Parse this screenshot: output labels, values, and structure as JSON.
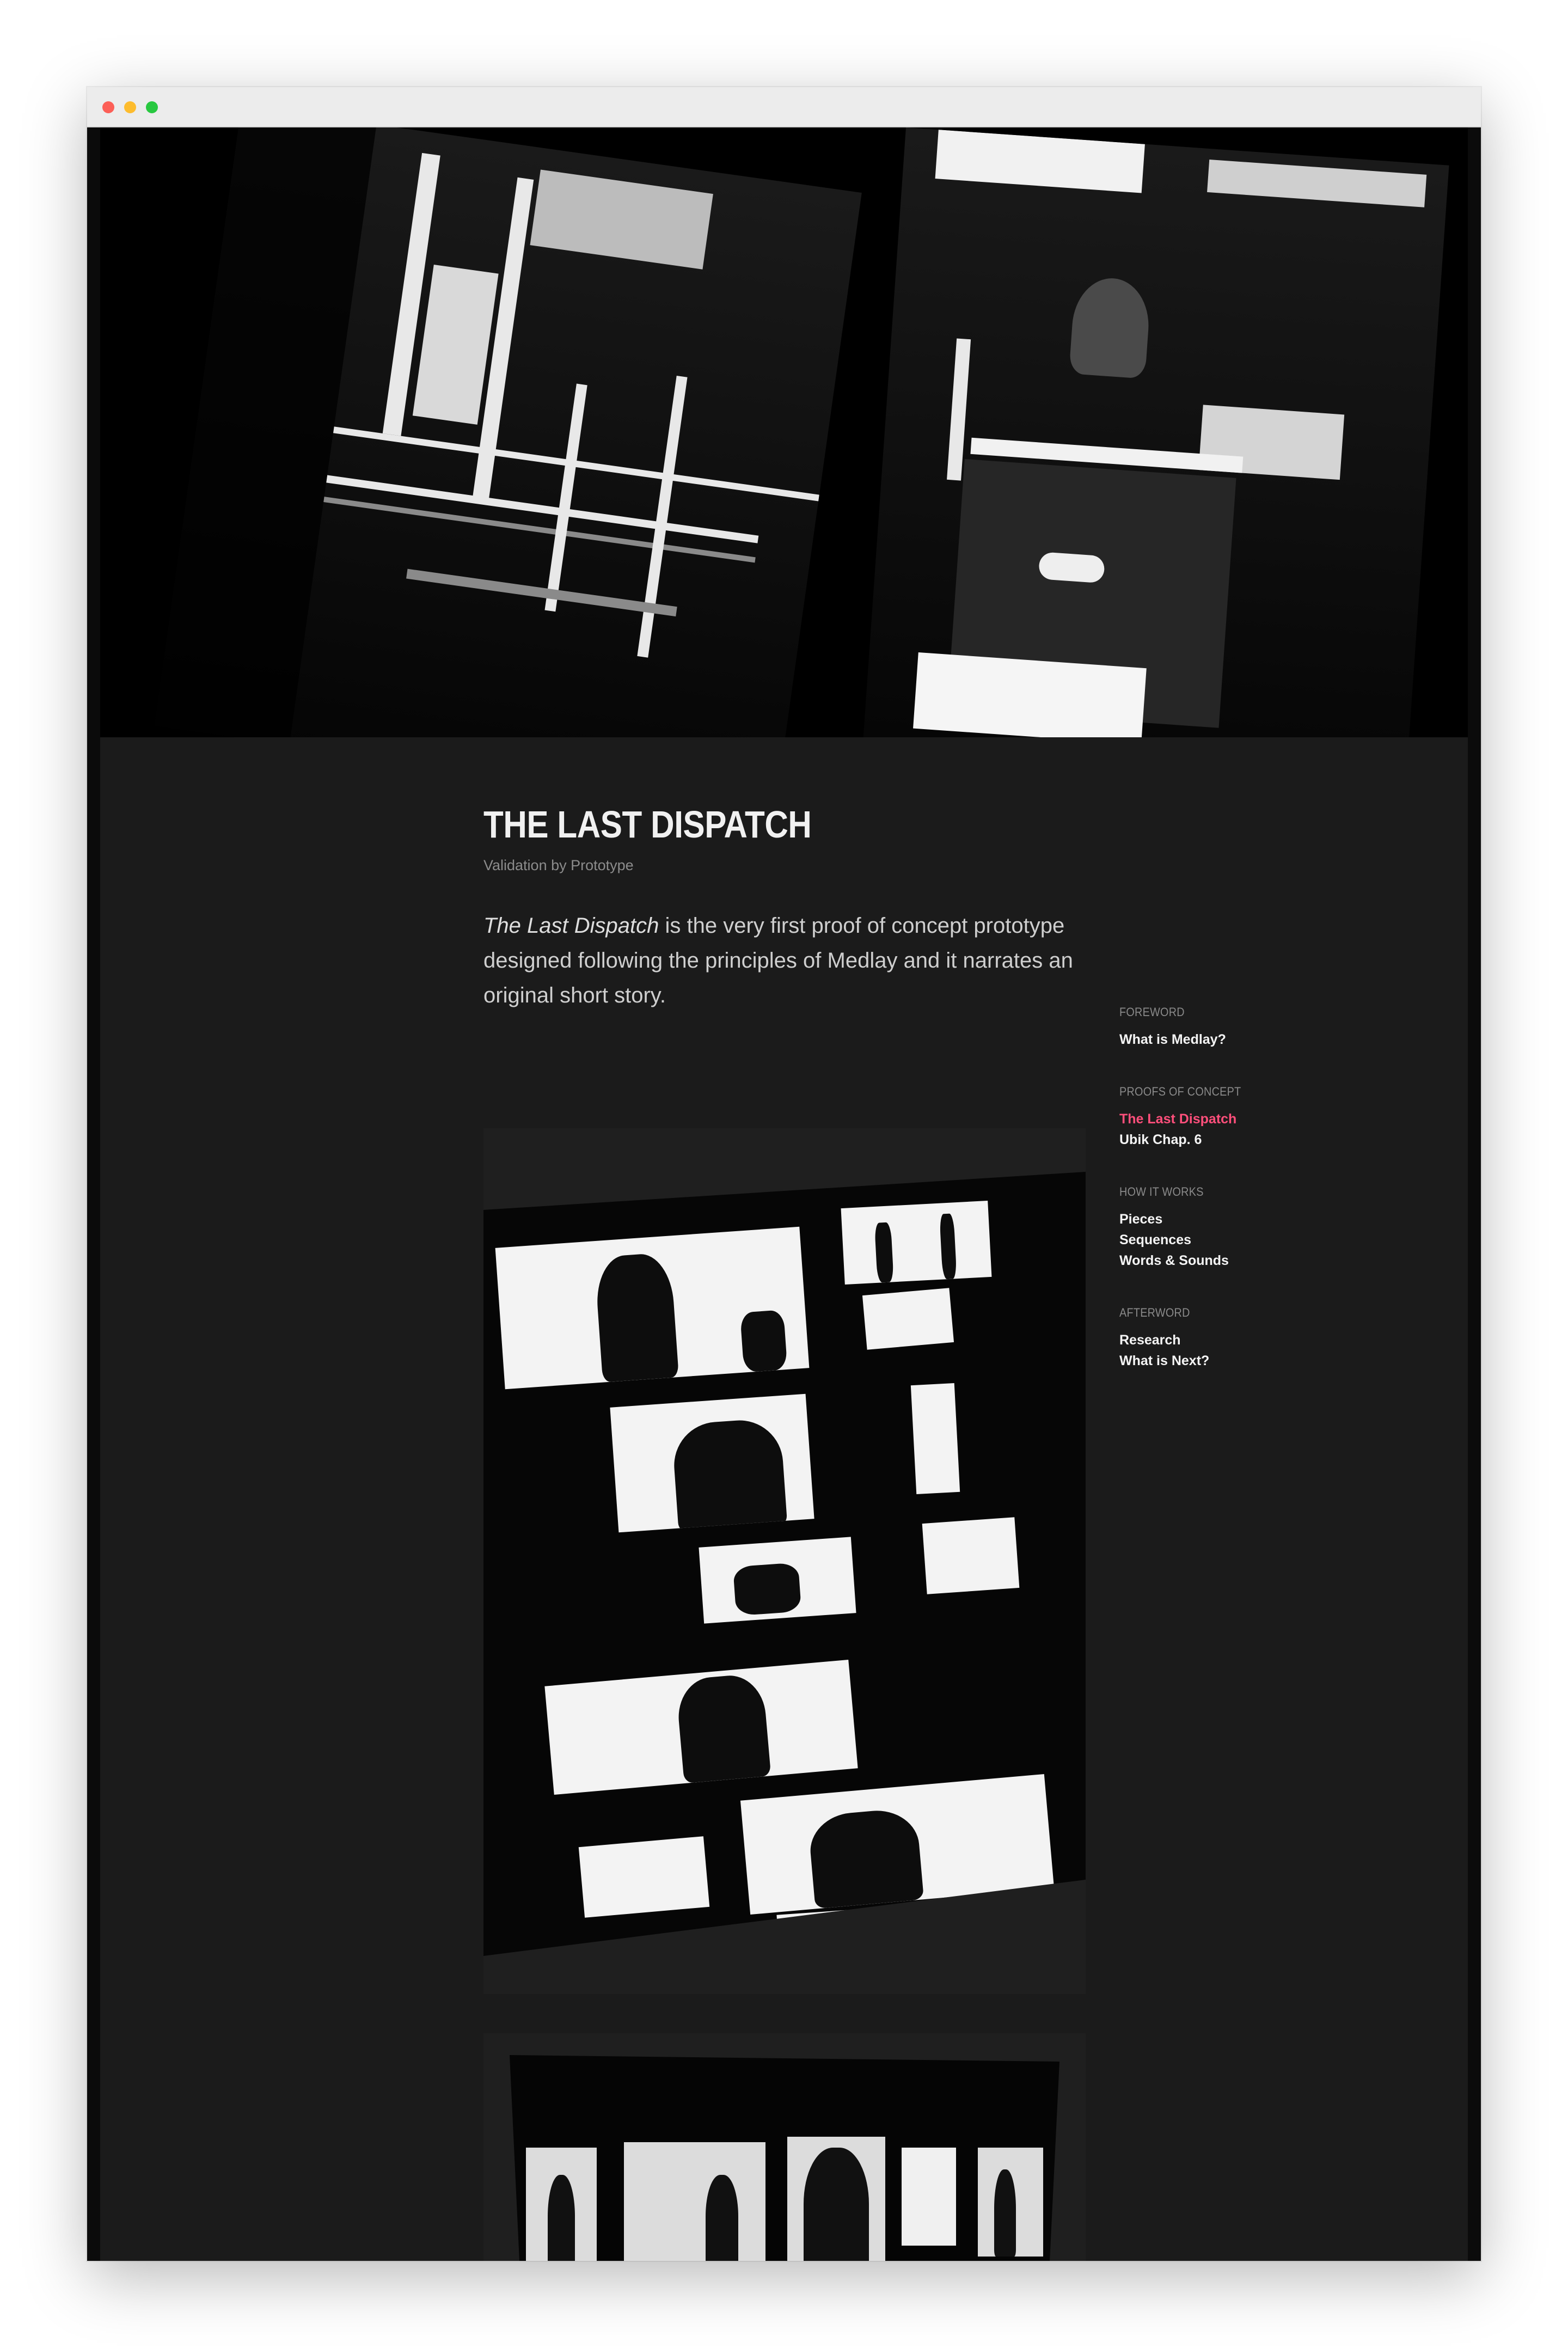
{
  "window": {
    "controls": [
      "close",
      "minimize",
      "zoom"
    ]
  },
  "article": {
    "title": "THE LAST DISPATCH",
    "subtitle": "Validation by Prototype",
    "intro_em": "The Last Dispatch",
    "intro_rest": " is the very first proof of concept prototype designed following the principles of Medlay and it narrates an original short story."
  },
  "toc": {
    "groups": [
      {
        "heading": "FOREWORD",
        "links": [
          "What is Medlay?"
        ]
      },
      {
        "heading": "PROOFS OF CONCEPT",
        "links": [
          "The Last Dispatch",
          "Ubik Chap. 6"
        ]
      },
      {
        "heading": "HOW IT WORKS",
        "links": [
          "Pieces",
          "Sequences",
          "Words & Sounds"
        ]
      },
      {
        "heading": "AFTERWORD",
        "links": [
          "Research",
          "What is Next?"
        ]
      }
    ],
    "active": "The Last Dispatch"
  },
  "colors": {
    "page_background": "#1b1b1b",
    "accent": "#ff4f7b",
    "heading_text": "#f1f1f1",
    "muted_text": "#8a8a8a"
  }
}
